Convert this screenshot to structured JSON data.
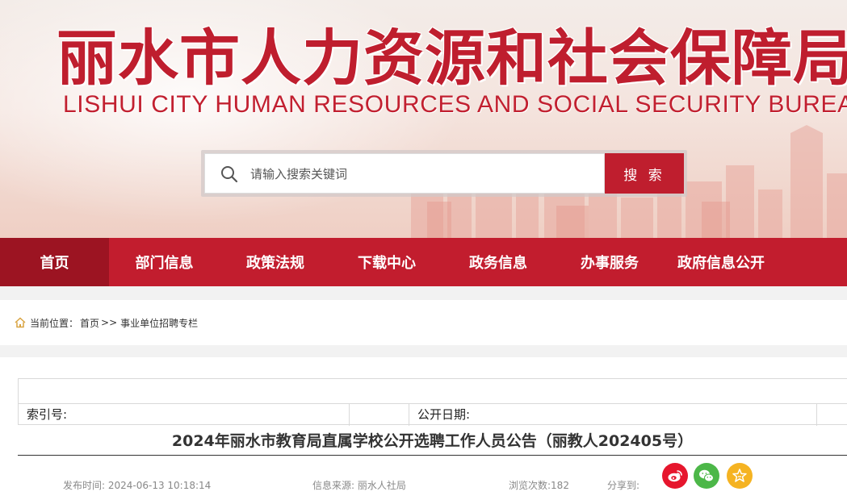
{
  "header": {
    "title": "丽水市人力资源和社会保障局",
    "subtitle": "LISHUI CITY HUMAN RESOURCES AND SOCIAL SECURITY BUREAU"
  },
  "search": {
    "placeholder": "请输入搜索关键词",
    "button_label": "搜 索"
  },
  "nav": {
    "items": [
      {
        "label": "首页"
      },
      {
        "label": "部门信息"
      },
      {
        "label": "政策法规"
      },
      {
        "label": "下载中心"
      },
      {
        "label": "政务信息"
      },
      {
        "label": "办事服务"
      },
      {
        "label": "政府信息公开"
      }
    ]
  },
  "breadcrumb": {
    "prefix": "当前位置：",
    "home": "首页",
    "separator": ">>",
    "current": "事业单位招聘专栏"
  },
  "meta": {
    "index_label": "索引号:",
    "date_label": "公开日期:"
  },
  "article": {
    "title": "2024年丽水市教育局直属学校公开选聘工作人员公告（丽教人202405号）",
    "publish_time": "发布时间: 2024-06-13 10:18:14",
    "source": "信息来源: 丽水人社局",
    "views": "浏览次数:182",
    "share_label": "分享到:"
  },
  "colors": {
    "brand_red": "#c21d2e",
    "nav_active": "#9c1422",
    "weibo": "#e6162d",
    "wechat": "#4cb748",
    "favorite": "#f5b322"
  },
  "icons": [
    "search-icon",
    "home-icon",
    "weibo-icon",
    "wechat-icon",
    "star-icon"
  ]
}
